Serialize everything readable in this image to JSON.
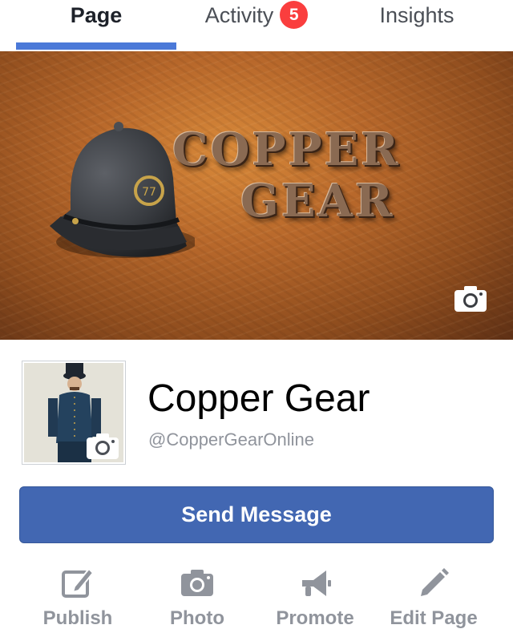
{
  "tabs": {
    "page": "Page",
    "activity": "Activity",
    "activity_badge": "5",
    "insights": "Insights",
    "active": "page"
  },
  "cover": {
    "logo_line1": "COPPER",
    "logo_line2": "GEAR",
    "camera_icon": "camera-icon"
  },
  "profile": {
    "name": "Copper Gear",
    "handle": "@CopperGearOnline",
    "camera_icon": "camera-icon"
  },
  "send_message": "Send Message",
  "actions": [
    {
      "label": "Publish",
      "icon": "compose-icon"
    },
    {
      "label": "Photo",
      "icon": "camera-icon"
    },
    {
      "label": "Promote",
      "icon": "megaphone-icon"
    },
    {
      "label": "Edit Page",
      "icon": "pencil-icon"
    }
  ],
  "colors": {
    "accent": "#4b79d8",
    "button": "#4267b2",
    "badge": "#fa3e3e",
    "muted": "#90949c"
  }
}
